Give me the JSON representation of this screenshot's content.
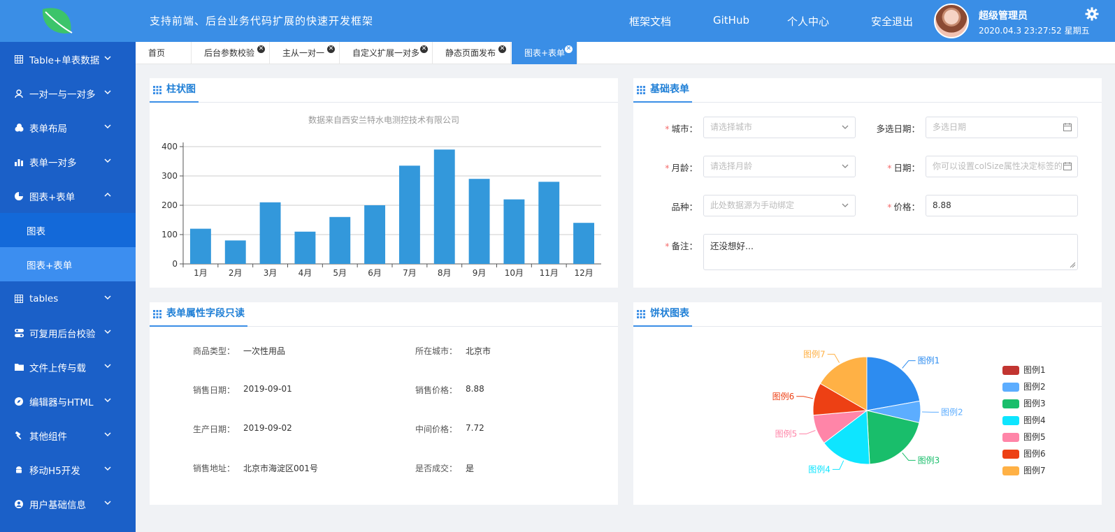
{
  "header": {
    "slogan": "支持前端、后台业务代码扩展的快速开发框架",
    "nav": [
      "框架文档",
      "GitHub",
      "个人中心",
      "安全退出"
    ],
    "user_name": "超级管理员",
    "user_time": "2020.04.3 23:27:52 星期五",
    "brand_color": "#3a8ee6"
  },
  "sidebar": {
    "items": [
      {
        "label": "Table+单表数据",
        "icon": "table-icon"
      },
      {
        "label": "一对一与一对多",
        "icon": "user-icon"
      },
      {
        "label": "表单布局",
        "icon": "cubes-icon"
      },
      {
        "label": "表单一对多",
        "icon": "bar-chart-icon"
      },
      {
        "label": "图表+表单",
        "icon": "pie-icon"
      }
    ],
    "sub_items": [
      "图表",
      "图表+表单"
    ],
    "items2": [
      {
        "label": "tables",
        "icon": "table-icon"
      },
      {
        "label": "可复用后台校验",
        "icon": "toggle-icon"
      },
      {
        "label": "文件上传与载",
        "icon": "folder-icon"
      },
      {
        "label": "编辑器与HTML",
        "icon": "compass-icon"
      },
      {
        "label": "其他组件",
        "icon": "hammer-icon"
      },
      {
        "label": "移动H5开发",
        "icon": "android-icon"
      },
      {
        "label": "用户基础信息",
        "icon": "user-circle-icon"
      }
    ]
  },
  "tabs": [
    {
      "label": "首页"
    },
    {
      "label": "后台参数校验"
    },
    {
      "label": "主从一对一"
    },
    {
      "label": "自定义扩展一对多"
    },
    {
      "label": "静态页面发布"
    },
    {
      "label": "图表+表单"
    }
  ],
  "bar_panel": {
    "title": "柱状图"
  },
  "form_panel": {
    "title": "基础表单",
    "fields": {
      "city": {
        "label": "城市：",
        "placeholder": "请选择城市"
      },
      "multi_date": {
        "label": "多选日期：",
        "placeholder": "多选日期"
      },
      "age": {
        "label": "月龄：",
        "placeholder": "请选择月龄"
      },
      "date": {
        "label": "日期：",
        "placeholder": "你可以设置colSize属性决定标签的"
      },
      "breed": {
        "label": "品种：",
        "placeholder": "此处数据源为手动绑定"
      },
      "price": {
        "label": "价格：",
        "value": "8.88"
      },
      "remark": {
        "label": "备注：",
        "value": "还没想好..."
      }
    }
  },
  "readonly_panel": {
    "title": "表单属性字段只读",
    "rows": [
      {
        "l1": "商品类型：",
        "v1": "一次性用品",
        "l2": "所在城市：",
        "v2": "北京市"
      },
      {
        "l1": "销售日期：",
        "v1": "2019-09-01",
        "l2": "销售价格：",
        "v2": "8.88"
      },
      {
        "l1": "生产日期：",
        "v1": "2019-09-02",
        "l2": "中间价格：",
        "v2": "7.72"
      },
      {
        "l1": "销售地址：",
        "v1": "北京市海淀区001号",
        "l2": "是否成交：",
        "v2": "是"
      }
    ]
  },
  "pie_panel": {
    "title": "饼状图表"
  },
  "chart_data": [
    {
      "type": "bar",
      "title": "数据来自西安兰特水电测控技术有限公司",
      "categories": [
        "1月",
        "2月",
        "3月",
        "4月",
        "5月",
        "6月",
        "7月",
        "8月",
        "9月",
        "10月",
        "11月",
        "12月"
      ],
      "values": [
        120,
        80,
        210,
        110,
        160,
        200,
        335,
        390,
        290,
        220,
        280,
        140
      ],
      "ylim": [
        0,
        400
      ],
      "yticks": [
        0,
        100,
        200,
        300,
        400
      ],
      "color": "#3398db",
      "grid": true
    },
    {
      "type": "pie",
      "labels": [
        "图例1",
        "图例2",
        "图例3",
        "图例4",
        "图例5",
        "图例6",
        "图例7"
      ],
      "values": [
        335,
        98,
        310,
        234,
        135,
        148,
        251
      ],
      "colors": [
        "#2d8cf0",
        "#5cadff",
        "#19be6b",
        "#0ee5ff",
        "#ff85a8",
        "#ed4014",
        "#ffb145"
      ],
      "legend_colors": [
        "#c23531",
        "#5cadff",
        "#19be6b",
        "#0ee5ff",
        "#ff85a8",
        "#ed4014",
        "#ffb145"
      ],
      "legend_position": "right"
    }
  ]
}
